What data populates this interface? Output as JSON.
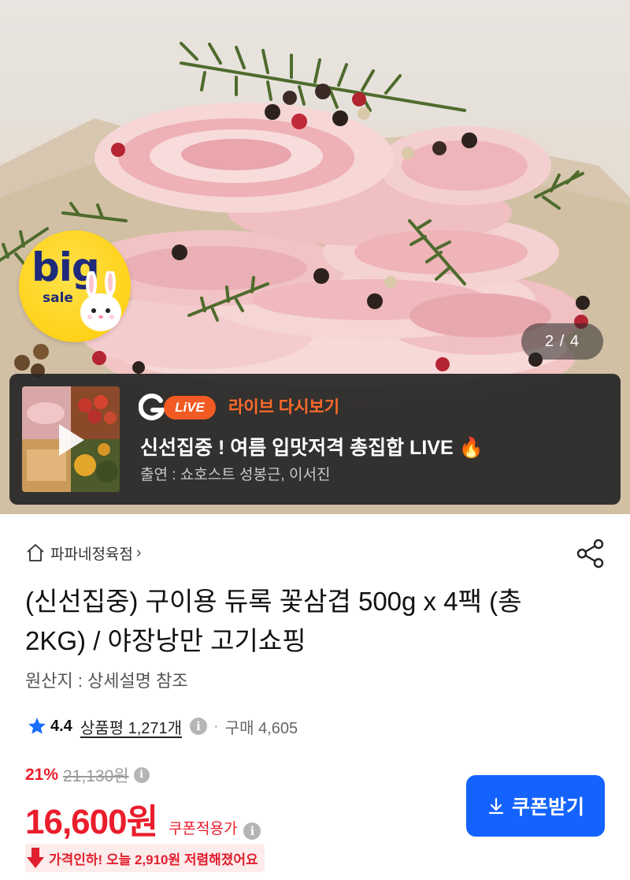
{
  "hero": {
    "badge": {
      "line1": "big",
      "line2": "sale"
    },
    "page_counter": "2 / 4"
  },
  "live": {
    "live_label": "LiVE",
    "replay_label": "라이브 다시보기",
    "title": "신선집중 ! 여름 입맛저격 총집합 LIVE 🔥",
    "cast": "출연 : 쇼호스트 성봉근, 이서진"
  },
  "product": {
    "store_name": "파파네정육점",
    "store_chevron": "›",
    "title": "(신선집중) 구이용 듀록 꽃삼겹 500g x 4팩 (총 2KG) / 야장낭만 고기쇼핑",
    "origin": "원산지 : 상세설명 참조",
    "rating": "4.4",
    "review_link": "상품평 1,271개",
    "separator": "·",
    "purchase_count": "구매 4,605",
    "discount_rate": "21%",
    "original_price": "21,130원",
    "price": "16,600원",
    "coupon_applied": "쿠폰적용가",
    "coupon_button": "쿠폰받기",
    "price_drop": "가격인하! 오늘 2,910원 저렴해졌어요"
  },
  "icons": {
    "home": "home-icon",
    "share": "share-icon",
    "star": "star-icon",
    "info": "i",
    "download": "download-icon",
    "price_drop": "arrow-down-icon"
  },
  "colors": {
    "accent_blue": "#1563ff",
    "sale_red": "#ea1d2c",
    "live_orange": "#f15a22",
    "badge_yellow": "#ffd21a",
    "badge_navy": "#1f2a7a"
  }
}
